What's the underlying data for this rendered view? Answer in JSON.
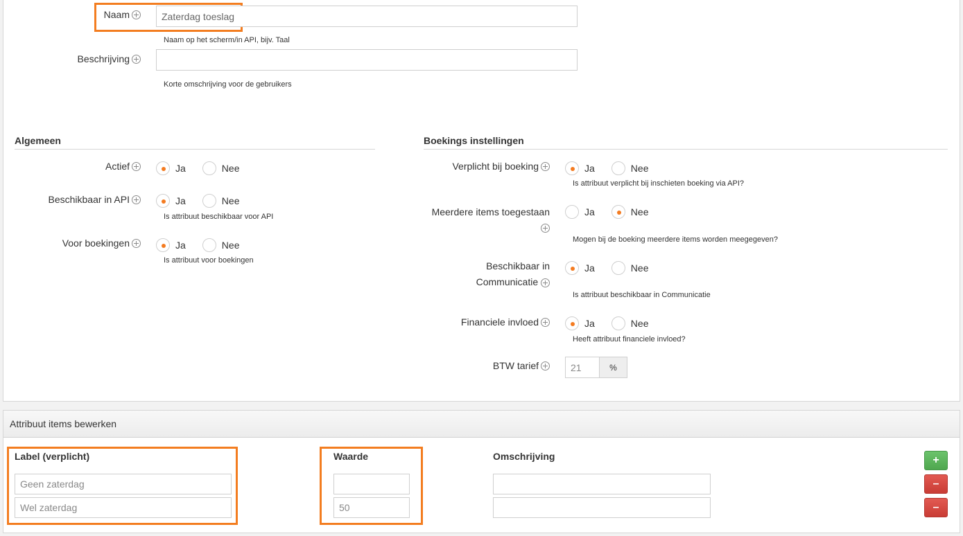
{
  "general": {
    "name_label": "Naam",
    "name_value": "Zaterdag toeslag",
    "name_help": "Naam op het scherm/in API, bijv. Taal",
    "description_label": "Beschrijving",
    "description_value": "",
    "description_help": "Korte omschrijving voor de gebruikers"
  },
  "algemeen": {
    "title": "Algemeen",
    "rows": [
      {
        "label": "Actief",
        "selected": "Ja",
        "help": ""
      },
      {
        "label": "Beschikbaar in API",
        "selected": "Ja",
        "help": "Is attribuut beschikbaar voor API"
      },
      {
        "label": "Voor boekingen",
        "selected": "Ja",
        "help": "Is attribuut voor boekingen"
      }
    ]
  },
  "boekings": {
    "title": "Boekings instellingen",
    "rows": [
      {
        "label": "Verplicht bij boeking",
        "selected": "Ja",
        "help": "Is attribuut verplicht bij inschieten boeking via API?"
      },
      {
        "label": "Meerdere items toegestaan",
        "selected": "Nee",
        "help": "Mogen bij de boeking meerdere items worden meegegeven?"
      },
      {
        "label_line1": "Beschikbaar in",
        "label_line2": "Communicatie",
        "selected": "Ja",
        "help": "Is attribuut beschikbaar in Communicatie"
      },
      {
        "label": "Financiele invloed",
        "selected": "Ja",
        "help": "Heeft attribuut financiele invloed?"
      }
    ],
    "btw_label": "BTW tarief",
    "btw_value": "21",
    "btw_unit": "%"
  },
  "radio_options": {
    "yes": "Ja",
    "no": "Nee"
  },
  "items_panel": {
    "title": "Attribuut items bewerken",
    "col_label": "Label (verplicht)",
    "col_value": "Waarde",
    "col_description": "Omschrijving",
    "add_button": "+",
    "remove_button": "–",
    "rows": [
      {
        "label": "Geen zaterdag",
        "value": "",
        "description": ""
      },
      {
        "label": "Wel zaterdag",
        "value": "50",
        "description": ""
      }
    ]
  },
  "colors": {
    "accent": "#f37d20",
    "radio_dot": "#f47b20",
    "add": "#5cb85c",
    "remove": "#d9534f"
  }
}
